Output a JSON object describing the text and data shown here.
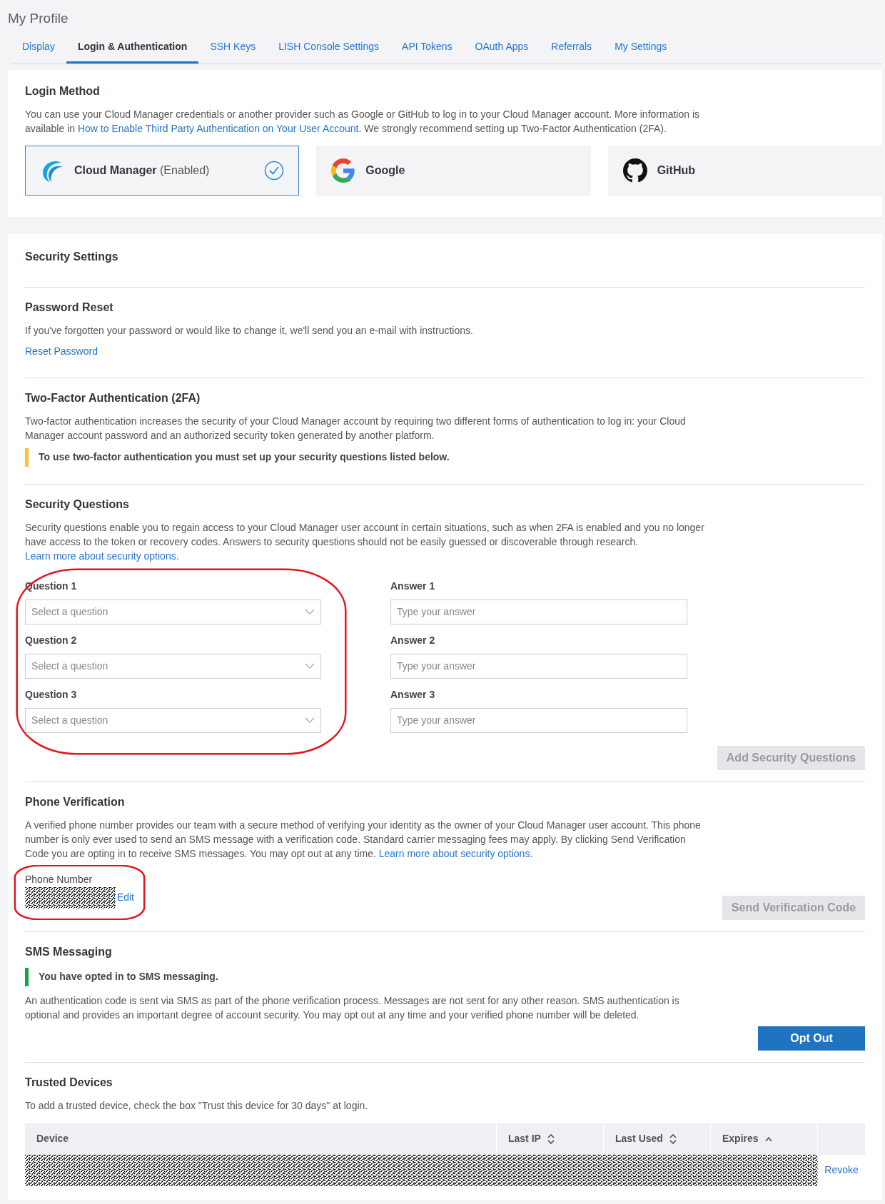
{
  "page_title": "My Profile",
  "tabs": [
    {
      "label": "Display",
      "selected": false
    },
    {
      "label": "Login & Authentication",
      "selected": true
    },
    {
      "label": "SSH Keys",
      "selected": false
    },
    {
      "label": "LISH Console Settings",
      "selected": false
    },
    {
      "label": "API Tokens",
      "selected": false
    },
    {
      "label": "OAuth Apps",
      "selected": false
    },
    {
      "label": "Referrals",
      "selected": false
    },
    {
      "label": "My Settings",
      "selected": false
    }
  ],
  "login_method": {
    "title": "Login Method",
    "description": {
      "before": "You can use your Cloud Manager credentials or another provider such as Google or GitHub to log in to your Cloud Manager account. More information is available in ",
      "link": "How to Enable Third Party Authentication on Your User Account",
      "after": ". We strongly recommend setting up Two-Factor Authentication (2FA)."
    },
    "providers": [
      {
        "kind": "cloud",
        "name": "Cloud Manager",
        "status": "(Enabled)",
        "selected": true
      },
      {
        "kind": "google",
        "name": "Google",
        "selected": false
      },
      {
        "kind": "github",
        "name": "GitHub",
        "selected": false
      }
    ]
  },
  "security": {
    "title": "Security Settings",
    "password_reset": {
      "title": "Password Reset",
      "description": "If you've forgotten your password or would like to change it, we'll send you an e-mail with instructions.",
      "link": "Reset Password"
    },
    "two_factor": {
      "title": "Two-Factor Authentication (2FA)",
      "description": "Two-factor authentication increases the security of your Cloud Manager account by requiring two different forms of authentication to log in: your Cloud Manager account password and an authorized security token generated by another platform.",
      "notice": {
        "kind": "warning",
        "text": "To use two-factor authentication you must set up your security questions listed below."
      }
    },
    "security_questions": {
      "title": "Security Questions",
      "description": {
        "before": "Security questions enable you to regain access to your Cloud Manager user account in certain situations, such as when 2FA is enabled and you no longer have access to the token or recovery codes. Answers to security questions should not be easily guessed or discoverable through research. ",
        "link": "Learn more about security options."
      },
      "questions": [
        {
          "label": "Question 1",
          "placeholder": "Select a question",
          "answer_label": "Answer 1",
          "answer_placeholder": "Type your answer"
        },
        {
          "label": "Question 2",
          "placeholder": "Select a question",
          "answer_label": "Answer 2",
          "answer_placeholder": "Type your answer"
        },
        {
          "label": "Question 3",
          "placeholder": "Select a question",
          "answer_label": "Answer 3",
          "answer_placeholder": "Type your answer"
        }
      ],
      "button": {
        "label": "Add Security Questions",
        "disabled": true
      }
    },
    "phone_verification": {
      "title": "Phone Verification",
      "description": {
        "before": "A verified phone number provides our team with a secure method of verifying your identity as the owner of your Cloud Manager user account. This phone number is only ever used to send an SMS message with a verification code. Standard carrier messaging fees may apply. By clicking Send Verification Code you are opting in to receive SMS messages. You may opt out at any time. ",
        "link": "Learn more about security options."
      },
      "phone_label": "Phone Number",
      "edit_link": "Edit",
      "button": {
        "label": "Send Verification Code",
        "disabled": true
      }
    },
    "sms": {
      "title": "SMS Messaging",
      "notice": {
        "kind": "success",
        "text": "You have opted in to SMS messaging."
      },
      "description": "An authentication code is sent via SMS as part of the phone verification process. Messages are not sent for any other reason. SMS authentication is optional and provides an important degree of account security. You may opt out at any time and your verified phone number will be deleted.",
      "button": {
        "label": "Opt Out",
        "disabled": false
      }
    },
    "trusted_devices": {
      "title": "Trusted Devices",
      "description": "To add a trusted device, check the box \"Trust this device for 30 days\" at login.",
      "columns": [
        {
          "label": "Device",
          "kind": "plain"
        },
        {
          "label": "Last IP",
          "kind": "sortable"
        },
        {
          "label": "Last Used",
          "kind": "sortable"
        },
        {
          "label": "Expires",
          "kind": "sorted"
        }
      ],
      "rows": [
        {
          "action": "Revoke"
        }
      ]
    }
  }
}
